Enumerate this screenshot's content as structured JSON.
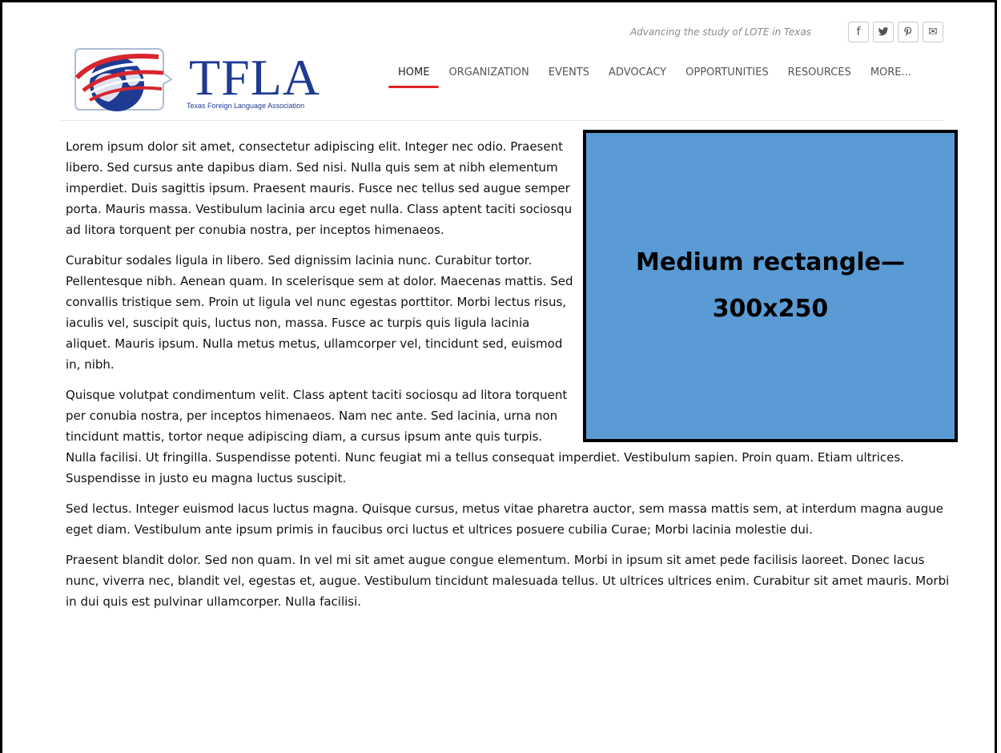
{
  "header": {
    "tagline": "Advancing the study of LOTE in Texas",
    "logo": {
      "word": "TFLA",
      "subtitle": "Texas Foreign Language Association"
    },
    "social": [
      {
        "icon": "facebook-icon",
        "glyph": "f"
      },
      {
        "icon": "twitter-icon",
        "glyph": "🐦"
      },
      {
        "icon": "pinterest-icon",
        "glyph": "P"
      },
      {
        "icon": "email-icon",
        "glyph": "✉"
      }
    ],
    "nav": [
      {
        "label": "HOME",
        "active": true
      },
      {
        "label": "ORGANIZATION"
      },
      {
        "label": "EVENTS"
      },
      {
        "label": "ADVOCACY"
      },
      {
        "label": "OPPORTUNITIES"
      },
      {
        "label": "RESOURCES"
      },
      {
        "label": "MORE..."
      }
    ]
  },
  "ad": {
    "line1": "Medium rectangle—",
    "line2": "300x250",
    "color": "#5b9bd5"
  },
  "main": {
    "paragraphs": [
      "Lorem ipsum dolor sit amet, consectetur adipiscing elit. Integer nec odio. Praesent libero. Sed cursus ante dapibus diam. Sed nisi. Nulla quis sem at nibh elementum imperdiet. Duis sagittis ipsum. Praesent mauris. Fusce nec tellus sed augue semper porta. Mauris massa. Vestibulum lacinia arcu eget nulla. Class aptent taciti sociosqu ad litora torquent per conubia nostra, per inceptos himenaeos.",
      "Curabitur sodales ligula in libero. Sed dignissim lacinia nunc. Curabitur tortor. Pellentesque nibh. Aenean quam. In scelerisque sem at dolor. Maecenas mattis. Sed convallis tristique sem. Proin ut ligula vel nunc egestas porttitor. Morbi lectus risus, iaculis vel, suscipit quis, luctus non, massa. Fusce ac turpis quis ligula lacinia aliquet. Mauris ipsum. Nulla metus metus, ullamcorper vel, tincidunt sed, euismod in, nibh.",
      "Quisque volutpat condimentum velit. Class aptent taciti sociosqu ad litora torquent per conubia nostra, per inceptos himenaeos. Nam nec ante. Sed lacinia, urna non tincidunt mattis, tortor neque adipiscing diam, a cursus ipsum ante quis turpis. Nulla facilisi. Ut fringilla. Suspendisse potenti. Nunc feugiat mi a tellus consequat imperdiet. Vestibulum sapien. Proin quam. Etiam ultrices. Suspendisse in justo eu magna luctus suscipit.",
      "Sed lectus. Integer euismod lacus luctus magna. Quisque cursus, metus vitae pharetra auctor, sem massa mattis sem, at interdum magna augue eget diam. Vestibulum ante ipsum primis in faucibus orci luctus et ultrices posuere cubilia Curae; Morbi lacinia molestie dui.",
      "Praesent blandit dolor. Sed non quam. In vel mi sit amet augue congue elementum. Morbi in ipsum sit amet pede facilisis laoreet. Donec lacus nunc, viverra nec, blandit vel, egestas et, augue. Vestibulum tincidunt malesuada tellus. Ut ultrices ultrices enim. Curabitur sit amet mauris. Morbi in dui quis est pulvinar ullamcorper. Nulla facilisi."
    ]
  }
}
